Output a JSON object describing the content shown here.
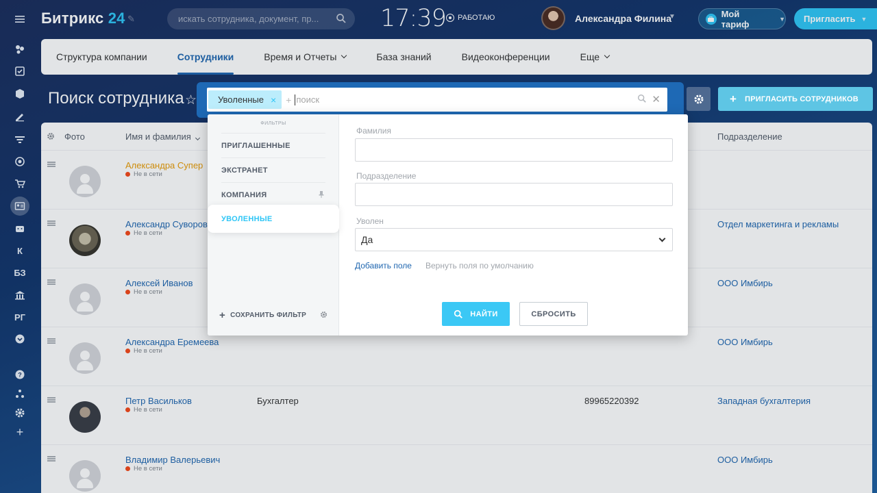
{
  "app": {
    "logo_text": "Битрикс",
    "logo_num": "24"
  },
  "search": {
    "placeholder": "искать сотрудника, документ, пр..."
  },
  "clock": "17:39",
  "work_status": "РАБОТАЮ",
  "user": {
    "name": "Александра Филина"
  },
  "tariff_label": "Мой тариф",
  "invite_label": "Пригласить",
  "left_bar": {
    "k": "К",
    "bz": "БЗ",
    "rg": "РГ"
  },
  "nav": {
    "items": [
      {
        "label": "Структура компании"
      },
      {
        "label": "Сотрудники"
      },
      {
        "label": "Время и Отчеты"
      },
      {
        "label": "База знаний"
      },
      {
        "label": "Видеоконференции"
      },
      {
        "label": "Еще"
      }
    ]
  },
  "page_title": "Поиск сотрудника",
  "filter": {
    "chip": "Уволенные",
    "placeholder": "поиск",
    "presets_title": "ФИЛЬТРЫ",
    "presets": [
      "ПРИГЛАШЕННЫЕ",
      "ЭКСТРАНЕТ",
      "КОМПАНИЯ",
      "УВОЛЕННЫЕ"
    ],
    "save_filter": "СОХРАНИТЬ ФИЛЬТР",
    "fields": {
      "lastname_label": "Фамилия",
      "department_label": "Подразделение",
      "fired_label": "Уволен",
      "fired_value": "Да"
    },
    "add_field": "Добавить поле",
    "reset_fields": "Вернуть поля по умолчанию",
    "find_button": "НАЙТИ",
    "reset_button": "СБРОСИТЬ"
  },
  "invite_employees_label": "ПРИГЛАСИТЬ СОТРУДНИКОВ",
  "table": {
    "headers": {
      "photo": "Фото",
      "name": "Имя и фамилия",
      "department": "Подразделение"
    },
    "rows": [
      {
        "name": "Александра Супер",
        "status": "Не в сети",
        "position": "",
        "phone": "",
        "department": ""
      },
      {
        "name": "Александр Суворов",
        "status": "Не в сети",
        "position": "",
        "phone": "",
        "department": "Отдел маркетинга и рекламы"
      },
      {
        "name": "Алексей Иванов",
        "status": "Не в сети",
        "position": "",
        "phone": "",
        "department": "ООО Имбирь"
      },
      {
        "name": "Александра Еремеева",
        "status": "Не в сети",
        "position": "",
        "phone": "",
        "department": "ООО Имбирь"
      },
      {
        "name": "Петр Васильков",
        "status": "Не в сети",
        "position": "Бухгалтер",
        "phone": "89965220392",
        "department": "Западная бухгалтерия"
      },
      {
        "name": "Владимир Валерьевич",
        "status": "Не в сети",
        "position": "",
        "phone": "",
        "department": "ООО Имбирь"
      }
    ]
  },
  "colors": {
    "accent": "#2fc6f6",
    "link": "#2067b0",
    "offline": "#f54819",
    "name_highlight": "#e89b06"
  }
}
